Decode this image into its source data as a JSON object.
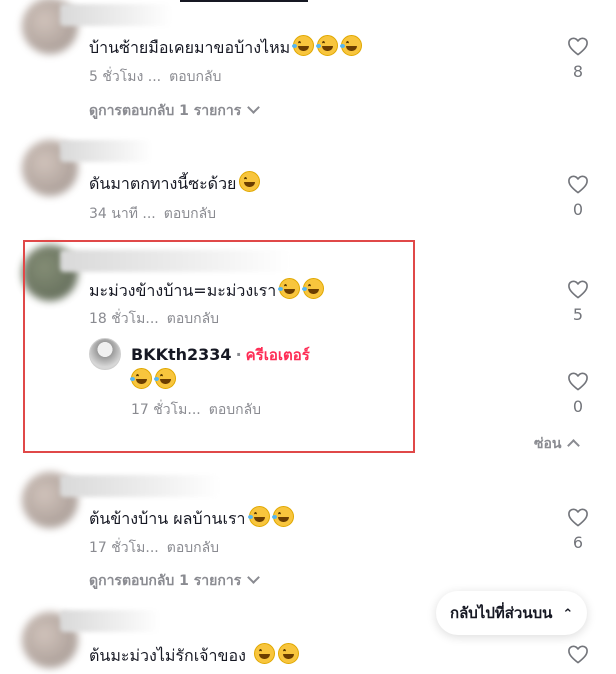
{
  "comments": [
    {
      "text": "บ้านซ้ายมือเคยมาขอบ้างไหม",
      "emojis": [
        "laugh",
        "laugh",
        "laugh"
      ],
      "time": "5 ชั่วโมง ...",
      "reply_label": "ตอบกลับ",
      "likes": "8",
      "view_replies": "ดูการตอบกลับ 1 รายการ"
    },
    {
      "text": "ดันมาตกทางนี้ซะด้วย",
      "emojis": [
        "grin"
      ],
      "time": "34 นาที ...",
      "reply_label": "ตอบกลับ",
      "likes": "0"
    },
    {
      "text": "มะม่วงข้างบ้าน=มะม่วงเรา",
      "emojis": [
        "laugh",
        "laugh"
      ],
      "time": "18 ชั่วโม...",
      "reply_label": "ตอบกลับ",
      "likes": "5",
      "reply": {
        "username": "BKKth2334",
        "badge": "ครีเอเตอร์",
        "emojis": [
          "laugh",
          "laugh"
        ],
        "time": "17 ชั่วโม...",
        "reply_label": "ตอบกลับ",
        "likes": "0"
      },
      "hide_label": "ซ่อน"
    },
    {
      "text": "ต้นข้างบ้าน ผลบ้านเรา",
      "emojis": [
        "laugh",
        "laugh"
      ],
      "time": "17 ชั่วโม...",
      "reply_label": "ตอบกลับ",
      "likes": "6",
      "view_replies": "ดูการตอบกลับ 1 รายการ"
    },
    {
      "text": "ต้นมะม่วงไม่รักเจ้าของ",
      "emojis": [
        "grin",
        "grin"
      ]
    }
  ],
  "back_to_top": "กลับไปที่ส่วนบน",
  "icons": {
    "like": "heart-outline-icon",
    "expand": "chevron-down-icon",
    "collapse": "chevron-up-icon",
    "back_to_top": "double-chevron-up-icon"
  },
  "colors": {
    "text": "#161823",
    "muted": "#8a8b91",
    "creator": "#fe2c55",
    "highlight": "#e04848"
  }
}
